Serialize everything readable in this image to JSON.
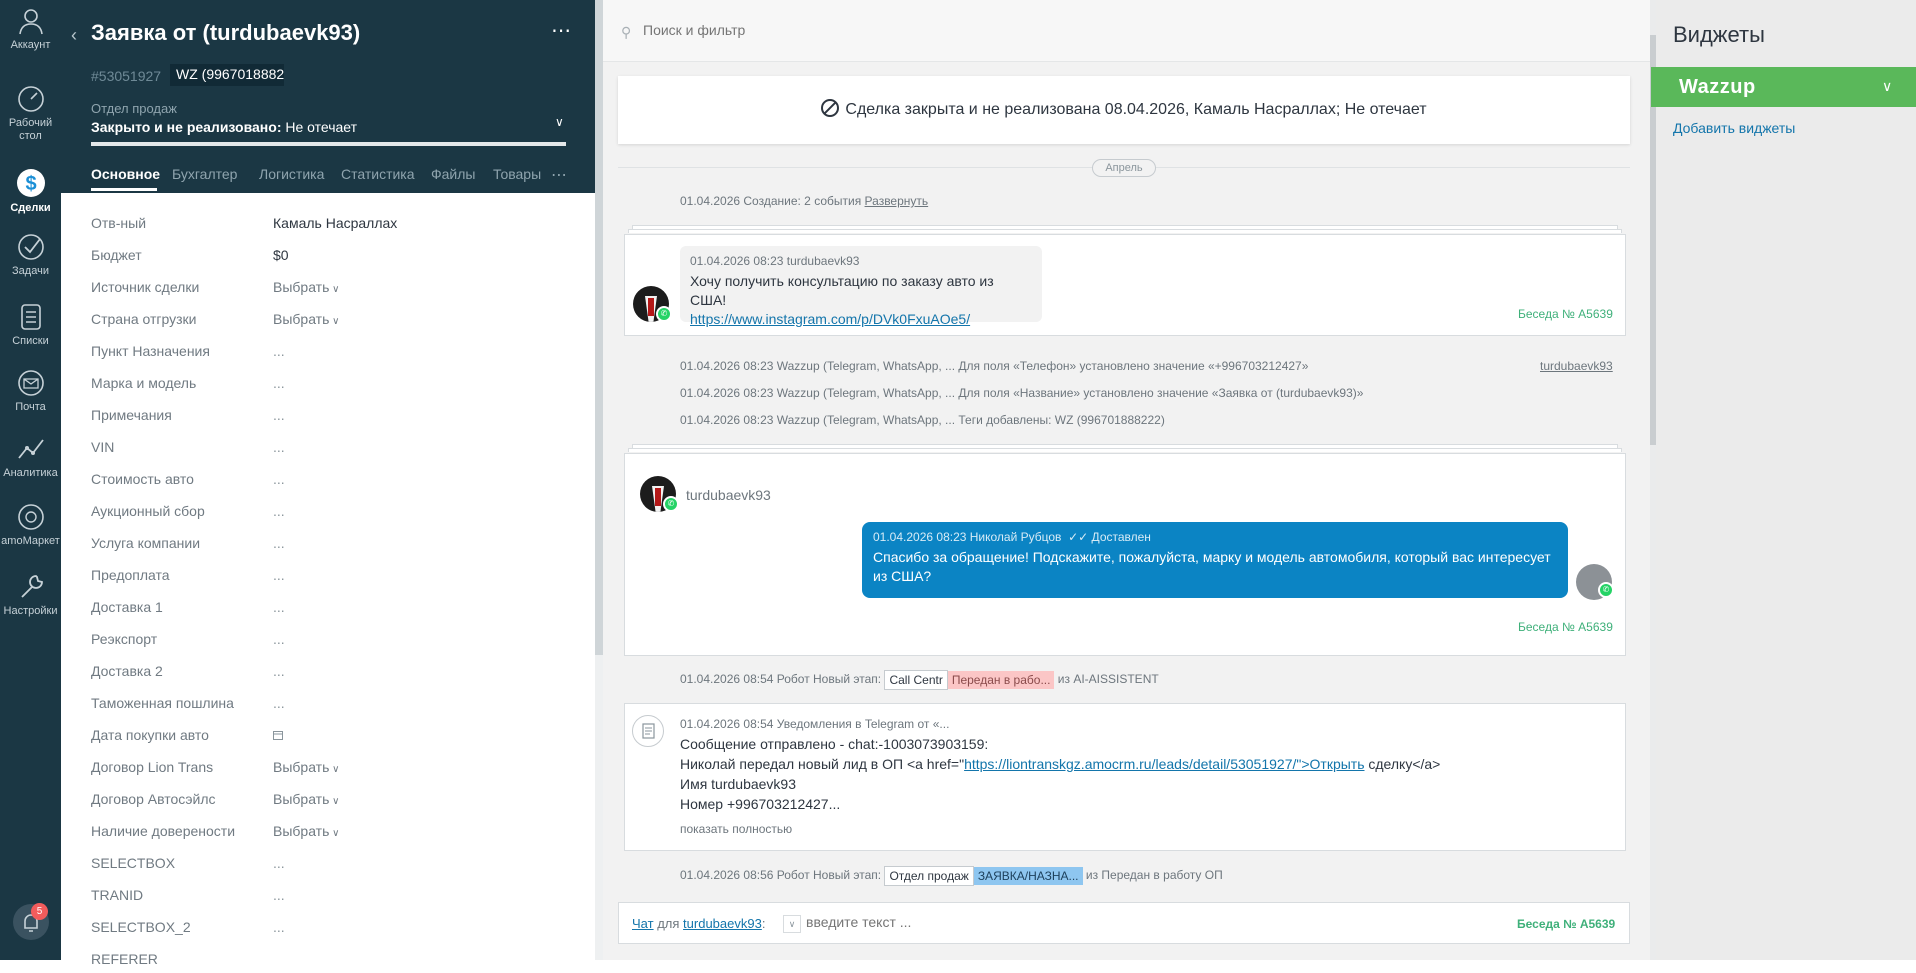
{
  "nav": {
    "items": [
      {
        "label": "Аккаунт",
        "icon": "user-icon"
      },
      {
        "label": "Рабочий стол",
        "icon": "dashboard-icon"
      },
      {
        "label": "Сделки",
        "icon": "deals-icon",
        "active": true
      },
      {
        "label": "Задачи",
        "icon": "tasks-icon"
      },
      {
        "label": "Списки",
        "icon": "lists-icon"
      },
      {
        "label": "Почта",
        "icon": "mail-icon"
      },
      {
        "label": "Аналитика",
        "icon": "analytics-icon"
      },
      {
        "label": "amoМаркет",
        "icon": "market-icon"
      },
      {
        "label": "Настройки",
        "icon": "settings-icon"
      }
    ],
    "notifications_count": "5"
  },
  "card": {
    "title": "Заявка от (turdubaevk93)",
    "lead_id": "#53051927",
    "tag": "WZ (996701888222)",
    "pipeline_label": "Отдел продаж",
    "status_bold": "Закрыто и не реализовано:",
    "status_reason": "Не отечает",
    "tabs": [
      "Основное",
      "Бухгалтерия",
      "Логистика",
      "Статистика",
      "Файлы",
      "Товары"
    ],
    "fields": [
      {
        "label": "Отв-ный",
        "value": "Камаль Насраллах",
        "kind": "text"
      },
      {
        "label": "Бюджет",
        "value": "$0",
        "kind": "budget"
      },
      {
        "label": "Источник сделки",
        "value": "Выбрать",
        "kind": "select"
      },
      {
        "label": "Страна отгрузки",
        "value": "Выбрать",
        "kind": "select"
      },
      {
        "label": "Пункт Назначения",
        "value": "...",
        "kind": "muted"
      },
      {
        "label": "Марка и модель",
        "value": "...",
        "kind": "muted"
      },
      {
        "label": "Примечания",
        "value": "...",
        "kind": "muted"
      },
      {
        "label": "VIN",
        "value": "...",
        "kind": "muted"
      },
      {
        "label": "Стоимость авто",
        "value": "...",
        "kind": "muted"
      },
      {
        "label": "Аукционный сбор",
        "value": "...",
        "kind": "muted"
      },
      {
        "label": "Услуга компании",
        "value": "...",
        "kind": "muted"
      },
      {
        "label": "Предоплата",
        "value": "...",
        "kind": "muted"
      },
      {
        "label": "Доставка 1",
        "value": "...",
        "kind": "muted"
      },
      {
        "label": "Реэкспорт",
        "value": "...",
        "kind": "muted"
      },
      {
        "label": "Доставка 2",
        "value": "...",
        "kind": "muted"
      },
      {
        "label": "Таможенная пошлина",
        "value": "...",
        "kind": "muted"
      },
      {
        "label": "Дата покупки авто",
        "value": "",
        "kind": "date"
      },
      {
        "label": "Договор Lion Trans",
        "value": "Выбрать",
        "kind": "select"
      },
      {
        "label": "Договор Автосэйлс",
        "value": "Выбрать",
        "kind": "select"
      },
      {
        "label": "Наличие доверености",
        "value": "Выбрать",
        "kind": "select"
      },
      {
        "label": "SELECTBOX",
        "value": "...",
        "kind": "muted"
      },
      {
        "label": "TRANID",
        "value": "...",
        "kind": "muted"
      },
      {
        "label": "SELECTBOX_2",
        "value": "...",
        "kind": "muted"
      },
      {
        "label": "REFERER",
        "value": "",
        "kind": "muted"
      }
    ]
  },
  "feed": {
    "search_placeholder": "Поиск и фильтр",
    "closed_banner": "Сделка закрыта и не реализована 08.04.2026, Камаль Насраллах; Не отечает",
    "month": "Апрель",
    "creation_event": "01.04.2026 Создание: 2 события",
    "expand_link": "Развернуть",
    "msg1": {
      "meta": "01.04.2026 08:23 turdubaevk93",
      "text": "Хочу получить консультацию по заказу авто из США!",
      "link": "https://www.instagram.com/p/DVk0FxuAOe5/",
      "conversation": "Беседа № A5639"
    },
    "system_events": [
      "01.04.2026 08:23 Wazzup (Telegram, WhatsApp, ... Для поля «Телефон» установлено значение «+996703212427»",
      "01.04.2026 08:23 Wazzup (Telegram, WhatsApp, ... Для поля «Название» установлено значение «Заявка от (turdubaevk93)»",
      "01.04.2026 08:23 Wazzup (Telegram, WhatsApp, ... Теги добавлены: WZ (996701888222)"
    ],
    "system_author": "turdubaevk93",
    "chat2": {
      "contact": "turdubaevk93",
      "out_meta": "01.04.2026 08:23 Николай Рубцов",
      "delivered": "✓✓ Доставлен",
      "out_text": "Спасибо за обращение! Подскажите, пожалуйста, марку и модель автомобиля, который вас интересует из США?",
      "conversation": "Беседа № A5639"
    },
    "robot1": {
      "prefix": "01.04.2026 08:54 Робот Новый этап:",
      "pipeline": "Call Centr",
      "stage": "Передан в рабо...",
      "suffix": "из AI-AISSISTENT"
    },
    "notify": {
      "meta": "01.04.2026 08:54 Уведомления в Telegram от «...",
      "line1": "Сообщение отправлено - chat:-1003073903159:",
      "line2_prefix": "Николай передал новый лид в ОП <a href=\"",
      "line2_link": "https://liontranskgz.amocrm.ru/leads/detail/53051927/\">Открыть",
      "line2_suffix": " сделку</a>",
      "line3": "Имя turdubaevk93",
      "line4": "Номер +996703212427...",
      "show_more": "показать полностью"
    },
    "robot2": {
      "prefix": "01.04.2026 08:56 Робот Новый этап:",
      "pipeline": "Отдел продаж",
      "stage": "ЗАЯВКА/НАЗНА...",
      "suffix": "из Передан в работу ОП"
    },
    "chat_input": {
      "chat_word": "Чат",
      "for_word": "для",
      "contact": "turdubaevk93",
      "placeholder": "введите текст ...",
      "conversation": "Беседа № A5639"
    }
  },
  "widgets": {
    "title": "Виджеты",
    "wazzup": "Wazzup",
    "add_link": "Добавить виджеты"
  },
  "colors": {
    "nav_bg": "#1b3744",
    "accent_green": "#5ab85a",
    "message_blue": "#0b84c4",
    "link_blue": "#1375ab"
  }
}
